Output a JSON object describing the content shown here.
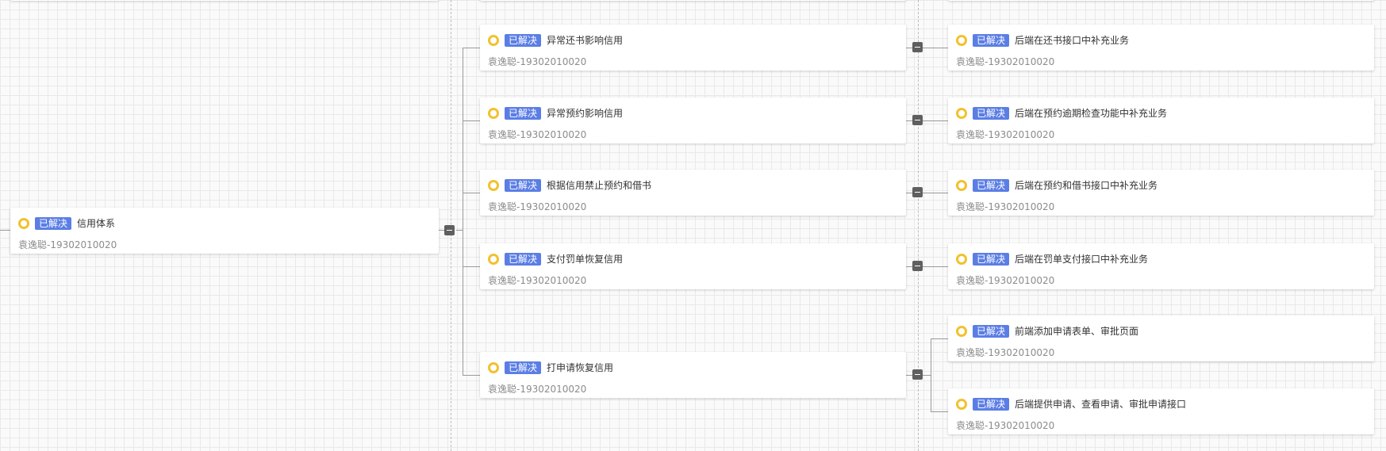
{
  "status_label": "已解决",
  "colors": {
    "tag": "#5b7ee5",
    "ring": "#f2c12e",
    "collapse": "#5f5f5f"
  },
  "root": {
    "title": "信用体系",
    "owner": "袁逸聪-19302010020"
  },
  "level2": [
    {
      "title": "异常还书影响信用",
      "owner": "袁逸聪-19302010020"
    },
    {
      "title": "异常预约影响信用",
      "owner": "袁逸聪-19302010020"
    },
    {
      "title": "根据信用禁止预约和借书",
      "owner": "袁逸聪-19302010020"
    },
    {
      "title": "支付罚单恢复信用",
      "owner": "袁逸聪-19302010020"
    },
    {
      "title": "打申请恢复信用",
      "owner": "袁逸聪-19302010020"
    }
  ],
  "level3": [
    {
      "title": "后端在还书接口中补充业务",
      "owner": "袁逸聪-19302010020"
    },
    {
      "title": "后端在预约逾期检查功能中补充业务",
      "owner": "袁逸聪-19302010020"
    },
    {
      "title": "后端在预约和借书接口中补充业务",
      "owner": "袁逸聪-19302010020"
    },
    {
      "title": "后端在罚单支付接口中补充业务",
      "owner": "袁逸聪-19302010020"
    },
    {
      "title": "前端添加申请表单、审批页面",
      "owner": "袁逸聪-19302010020"
    },
    {
      "title": "后端提供申请、查看申请、审批申请接口",
      "owner": "袁逸聪-19302010020"
    }
  ]
}
